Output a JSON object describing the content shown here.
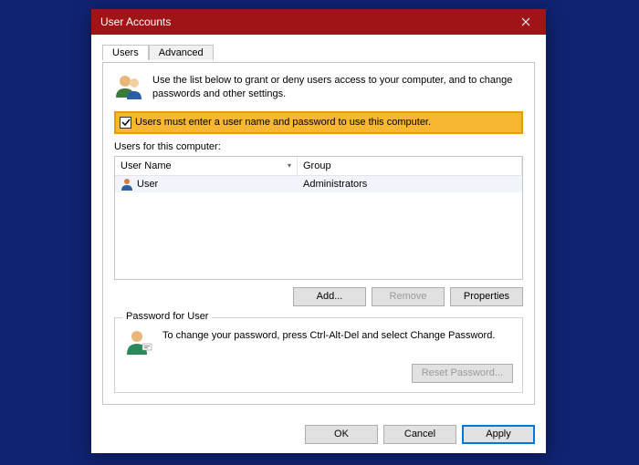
{
  "window": {
    "title": "User Accounts"
  },
  "tabs": {
    "users": "Users",
    "advanced": "Advanced"
  },
  "intro": "Use the list below to grant or deny users access to your computer, and to change passwords and other settings.",
  "checkbox_label": "Users must enter a user name and password to use this computer.",
  "users_heading": "Users for this computer:",
  "columns": {
    "name": "User Name",
    "group": "Group"
  },
  "rows": [
    {
      "name": "User",
      "group": "Administrators"
    }
  ],
  "buttons": {
    "add": "Add...",
    "remove": "Remove",
    "properties": "Properties",
    "reset": "Reset Password...",
    "ok": "OK",
    "cancel": "Cancel",
    "apply": "Apply"
  },
  "password_box": {
    "legend": "Password for User",
    "text": "To change your password, press Ctrl-Alt-Del and select Change Password."
  }
}
